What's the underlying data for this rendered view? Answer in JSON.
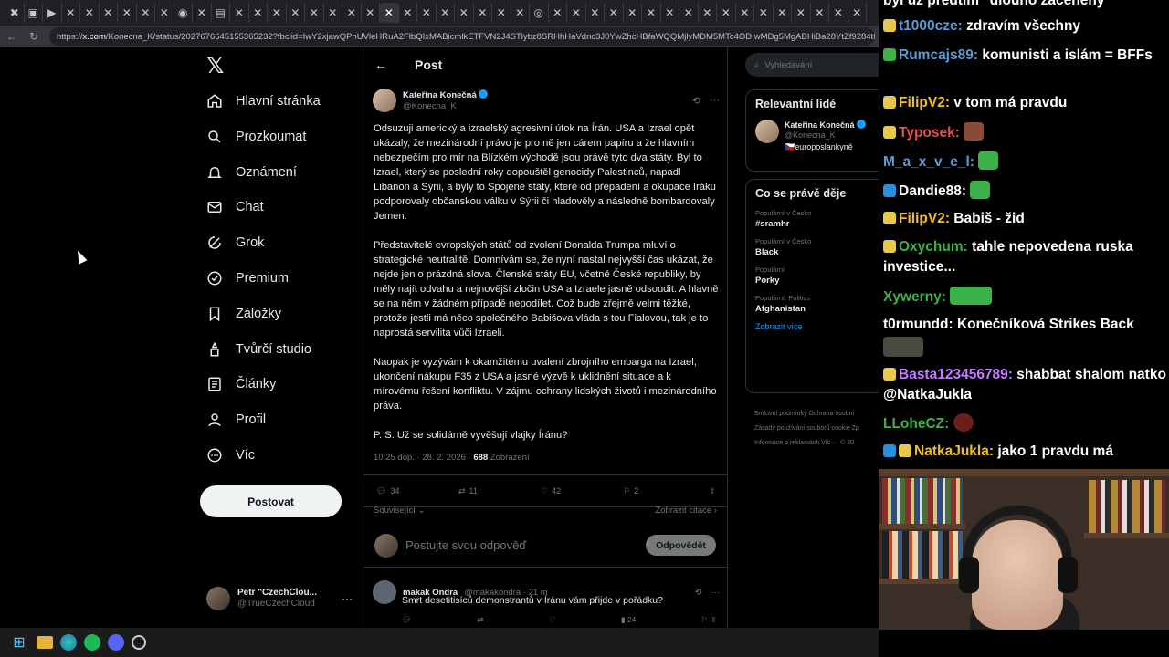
{
  "browser": {
    "url_prefix": "https://",
    "url_host": "x.com",
    "url_path": "/Konecna_K/status/2027676645155365232?fbclid=IwY2xjawQPnUVleHRuA2FlbQIxMABicmlkETFVN2J4STlybz8SRHhHaVdnc3J0YwZhcHBfaWQQMjlyMDM5MTc4ODIwMDg5MgABHiBa28YtZf9284tM_wFR7"
  },
  "nav": {
    "items": [
      {
        "label": "Hlavní stránka",
        "icon": "home-icon"
      },
      {
        "label": "Prozkoumat",
        "icon": "search-icon"
      },
      {
        "label": "Oznámení",
        "icon": "bell-icon"
      },
      {
        "label": "Chat",
        "icon": "mail-icon"
      },
      {
        "label": "Grok",
        "icon": "grok-icon"
      },
      {
        "label": "Premium",
        "icon": "premium-icon"
      },
      {
        "label": "Záložky",
        "icon": "bookmark-icon"
      },
      {
        "label": "Tvůrčí studio",
        "icon": "studio-icon"
      },
      {
        "label": "Články",
        "icon": "article-icon"
      },
      {
        "label": "Profil",
        "icon": "profile-icon"
      },
      {
        "label": "Víc",
        "icon": "more-icon"
      }
    ],
    "post_button": "Postovat",
    "account_name": "Petr \"CzechClou...",
    "account_handle": "@TrueCzechCloud"
  },
  "main": {
    "header_title": "Post",
    "author_name": "Kateřina Konečná",
    "author_handle": "@Konecna_K",
    "paragraphs": [
      "Odsuzuji americký a izraelský agresivní útok na Írán. USA a Izrael opět ukázaly, že mezinárodní právo je pro ně jen cárem papíru a že hlavním nebezpečím pro mír na Blízkém východě jsou právě tyto dva státy. Byl to Izrael, který se poslední roky dopouštěl genocidy Palestinců, napadl Libanon a Sýrii, a byly to Spojené státy, které od přepadení a okupace Iráku podporovaly občanskou válku v Sýrii či hladověly a následně bombardovaly Jemen.",
      "Představitelé evropských států od zvolení Donalda Trumpa mluví o strategické neutralitě. Domnívám se, že nyní nastal nejvyšší čas ukázat, že nejde jen o prázdná slova. Členské státy EU, včetně České republiky, by měly najít odvahu a nejnovější zločin USA a Izraele jasně odsoudit. A hlavně  se na něm v žádném případě nepodílet. Což bude zřejmě velmi těžké, protože jestli má něco společného Babišova vláda s tou Fialovou, tak je to naprostá servilita vůči Izraeli.",
      "Naopak je vyzývám k okamžitému uvalení zbrojního embarga na Izrael, ukončení nákupu F35 z USA a jasné výzvě k uklidnění situace a k mírovému řešení konfliktu. V zájmu ochrany lidských životů i mezinárodního práva.",
      "P. S. Už se solidárně vyvěšují vlajky Íránu?"
    ],
    "time": "10:25 dop. · 28. 2. 2026 · ",
    "views_count": "688",
    "views_label": " Zobrazení",
    "stats": {
      "replies": "34",
      "reposts": "11",
      "likes": "42",
      "bookmarks": "2"
    },
    "related": "Související",
    "show_quotes": "Zobrazit citace",
    "reply_placeholder": "Postujte svou odpověď",
    "reply_button": "Odpovědět",
    "reply": {
      "name": "makak Ondra",
      "handle": "@makakondra · 21 m",
      "text": "Smrt desetitisíců demonstrantů v Íránu vám přijde v pořádku?",
      "views": "24"
    }
  },
  "right": {
    "search_placeholder": "Vyhledávání",
    "relevant_title": "Relevantní lidé",
    "person_name": "Kateřina Konečná",
    "person_handle": "@Konecna_K",
    "person_bio": "europoslankyně",
    "trends_title": "Co se právě děje",
    "trends": [
      {
        "cat": "Populární v Česko",
        "topic": "#sramhr"
      },
      {
        "cat": "Populární v Česko",
        "topic": "Black"
      },
      {
        "cat": "Populární",
        "topic": "Porky"
      },
      {
        "cat": "Populární: Politics",
        "topic": "Afghanistan"
      }
    ],
    "show_more": "Zobrazit více",
    "footer_lines": [
      "Smluvní podmínky   Ochrana osobní",
      "Zásady používání souborů cookie   Zp",
      "Informace o reklamách   Víc ···   © 20"
    ]
  },
  "chat": {
    "messages": [
      {
        "user": "",
        "color": "#ffffff",
        "text": "byl už předtím \"dlouho začeněný",
        "badges": []
      },
      {
        "user": "t1000cze",
        "color": "#5b9bd5",
        "text": "zdravím všechny",
        "badges": [
          "#e6c84a"
        ]
      },
      {
        "user": "Rumcajs89",
        "color": "#5b9bd5",
        "text": "komunisti a islám = BFFs",
        "badges": [
          "#3cb34a"
        ]
      },
      {
        "user": "FilipV2",
        "color": "#f0c020",
        "text": "v tom má pravdu",
        "badges": [
          "#e6c84a"
        ]
      },
      {
        "user": "Typosek",
        "color": "#e0524a",
        "text": "",
        "badges": [
          "#e6c84a"
        ]
      },
      {
        "user": "M_a_x_v_e_l",
        "color": "#5b9bd5",
        "text": "",
        "badges": []
      },
      {
        "user": "Dandie88",
        "color": "#ffffff",
        "text": "",
        "badges": [
          "#2a8fe0"
        ]
      },
      {
        "user": "FilipV2",
        "color": "#f0c020",
        "text": "Babiš - žid",
        "badges": [
          "#e6c84a"
        ]
      },
      {
        "user": "Oxychum",
        "color": "#3cb34a",
        "text": "tahle nepovedena ruska investice...",
        "badges": [
          "#e6c84a"
        ]
      },
      {
        "user": "Xywerny",
        "color": "#3cb34a",
        "text": "",
        "badges": []
      },
      {
        "user": "t0rmundd",
        "color": "#ffffff",
        "text": "Konečníková Strikes Back",
        "badges": []
      },
      {
        "user": "Basta123456789",
        "color": "#c77dff",
        "text": "shabbat shalom natko @NatkaJukla",
        "badges": [
          "#e6c84a"
        ]
      },
      {
        "user": "LLoheCZ",
        "color": "#3cb34a",
        "text": "",
        "badges": []
      },
      {
        "user": "NatkaJukla",
        "color": "#f0c020",
        "text": "jako 1 pravdu má",
        "badges": [
          "#2a8fe0",
          "#e6c84a"
        ]
      }
    ]
  },
  "colors": {
    "accent": "#1d9bf0",
    "background": "#000000",
    "border": "#2f3336"
  }
}
